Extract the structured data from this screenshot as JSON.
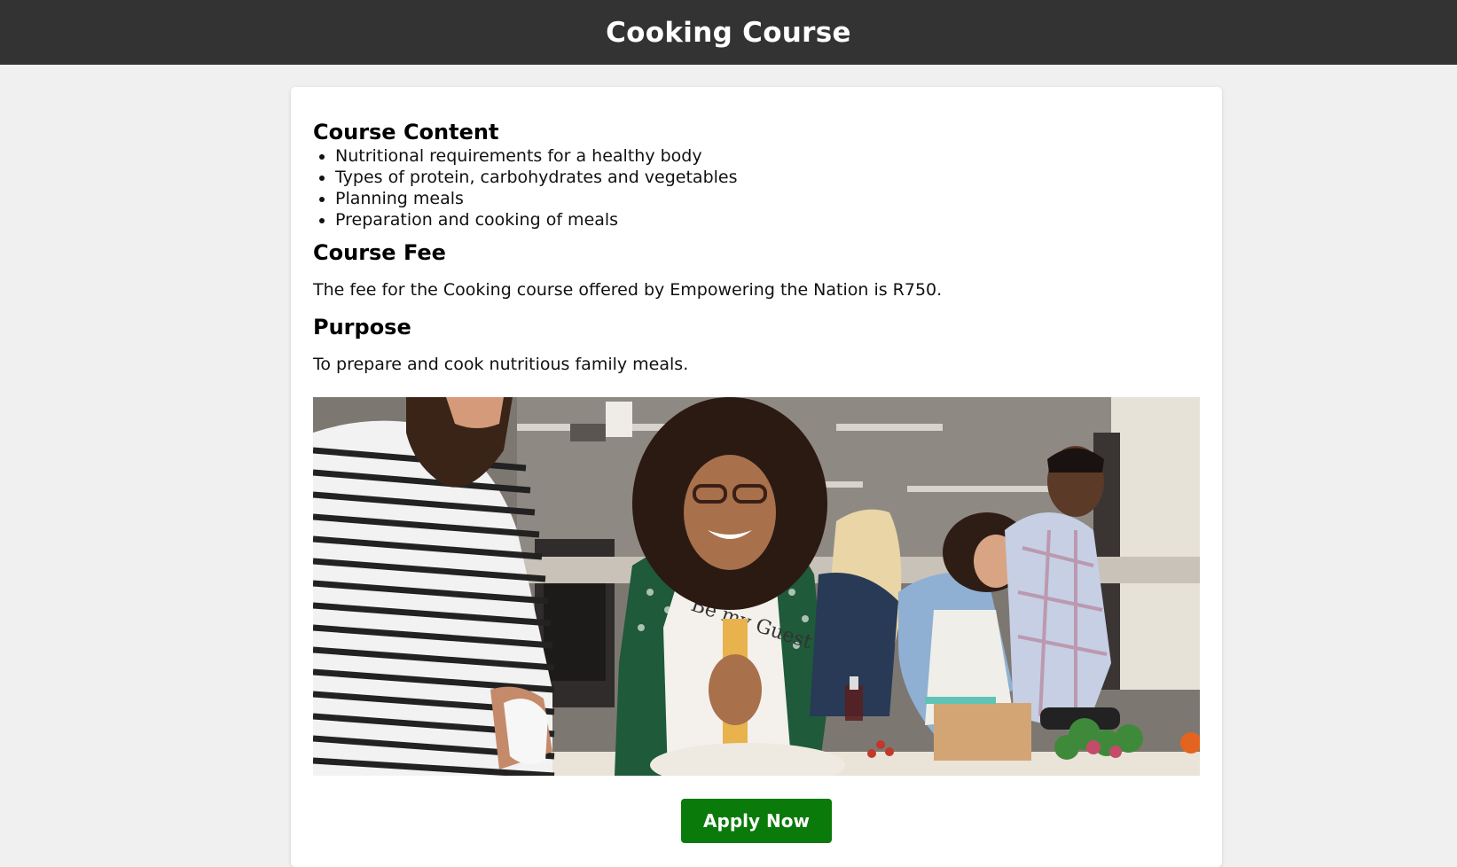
{
  "header": {
    "title": "Cooking Course"
  },
  "course_content": {
    "heading": "Course Content",
    "items": [
      "Nutritional requirements for a healthy body",
      "Types of protein, carbohydrates and vegetables",
      "Planning meals",
      "Preparation and cooking of meals"
    ]
  },
  "course_fee": {
    "heading": "Course Fee",
    "text": "The fee for the Cooking course offered by Empowering the Nation is R750."
  },
  "purpose": {
    "heading": "Purpose",
    "text": "To prepare and cook nutritious family meals."
  },
  "photo": {
    "apron_text": "Be my Guest"
  },
  "actions": {
    "apply_label": "Apply Now"
  },
  "colors": {
    "header_bg": "#333333",
    "page_bg": "#f0f0f0",
    "button_bg": "#0a7a0a"
  }
}
